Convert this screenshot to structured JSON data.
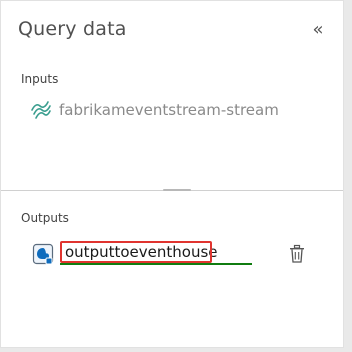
{
  "panel": {
    "title": "Query data",
    "collapse_icon": "double-chevron-left-icon"
  },
  "inputs": {
    "label": "Inputs",
    "items": [
      {
        "name": "fabrikameventstream-stream",
        "icon": "eventstream-icon"
      }
    ]
  },
  "outputs": {
    "label": "Outputs",
    "items": [
      {
        "name": "outputtoeventhouse",
        "icon": "eventhouse-icon",
        "action_icon": "trash-icon"
      }
    ]
  },
  "colors": {
    "focus_underline": "#107c10",
    "highlight_box": "#e0342f",
    "icon_teal": "#3a9e8f",
    "icon_blue": "#0f6cbd"
  }
}
